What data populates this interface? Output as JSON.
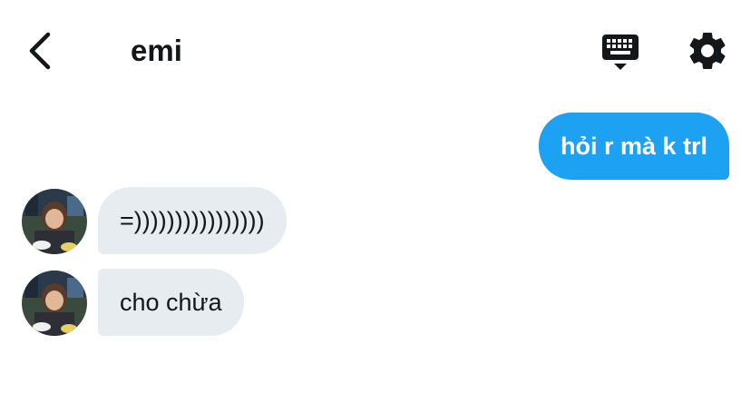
{
  "header": {
    "title": "emi",
    "icons": {
      "back": "chevron-left-icon",
      "keyboard": "keyboard-icon",
      "settings": "gear-icon"
    }
  },
  "messages": [
    {
      "direction": "sent",
      "text": "hỏi r mà k trl"
    },
    {
      "direction": "received",
      "text": "=))))))))))))))))"
    },
    {
      "direction": "received",
      "text": "cho chừa"
    }
  ],
  "colors": {
    "sent_bubble": "#1da1f2",
    "received_bubble": "#e6ecf0",
    "text_dark": "#14171a"
  }
}
